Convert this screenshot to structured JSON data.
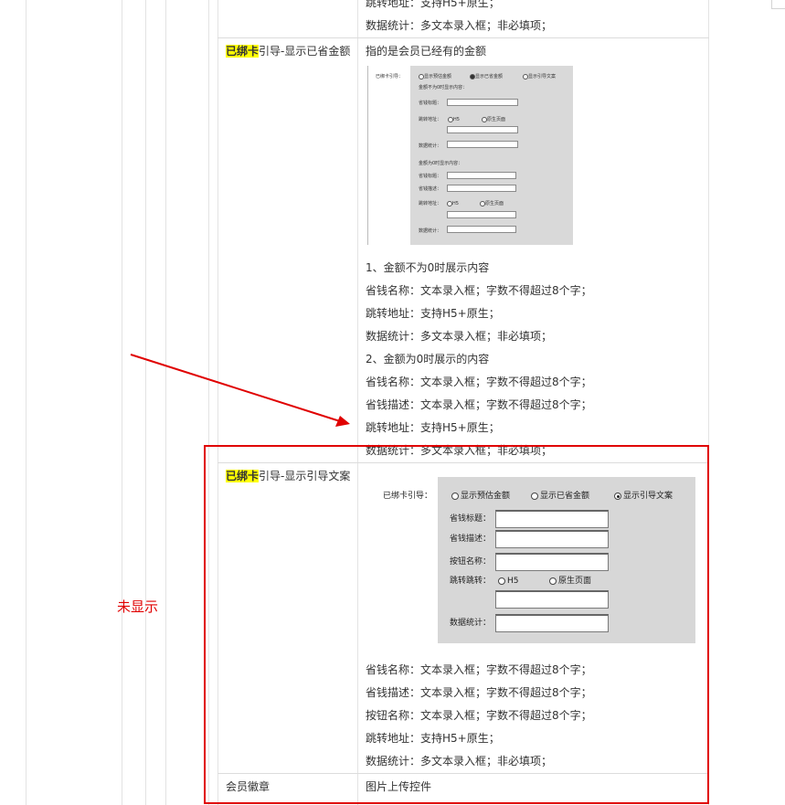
{
  "rows": {
    "top_fragment": {
      "line1": "跳转地址：支持H5+原生；",
      "line2": "数据统计：多文本录入框；非必填项；"
    },
    "row_saved_amount": {
      "label_highlight": "已绑卡",
      "label_rest": "引导-显示已省金额",
      "description": "指的是会员已经有的金额",
      "notes": [
        "1、金额不为0时展示内容",
        "省钱名称：文本录入框；字数不得超过8个字；",
        "跳转地址：支持H5+原生；",
        "数据统计：多文本录入框；非必填项；",
        "2、金额为0时展示的内容",
        "省钱名称：文本录入框；字数不得超过8个字；",
        "省钱描述：文本录入框；字数不得超过8个字；",
        "跳转地址：支持H5+原生；",
        "数据统计：多文本录入框；非必填项；"
      ]
    },
    "row_guide_text": {
      "label_highlight": "已绑卡",
      "label_rest": "引导-显示引导文案",
      "notes": [
        "省钱名称：文本录入框；字数不得超过8个字；",
        "省钱描述：文本录入框；字数不得超过8个字；",
        "按钮名称：文本录入框；字数不得超过8个字；",
        "跳转地址：支持H5+原生；",
        "数据统计：多文本录入框；非必填项；"
      ]
    },
    "row_badge": {
      "label": "会员徽章",
      "description": "图片上传控件"
    }
  },
  "annotation": {
    "text": "未显示",
    "color": "#e00000"
  },
  "screenshot_small": {
    "guide_label": "已绑卡引导：",
    "radio_options": [
      "显示预估金额",
      "显示已省金额",
      "显示引导文案"
    ],
    "selected_option": "显示已省金额",
    "section1_title": "金额不为0时显示内容：",
    "section2_title": "金额为0时显示内容：",
    "field_title": "省钱标题：",
    "field_desc": "省钱描述：",
    "field_jump": "跳转地址：",
    "field_stats": "数据统计：",
    "jump_options": [
      "H5",
      "原生页面"
    ]
  },
  "screenshot_large": {
    "guide_label": "已绑卡引导：",
    "radio_options": [
      "显示预估金额",
      "显示已省金额",
      "显示引导文案"
    ],
    "selected_option": "显示引导文案",
    "field_title": "省钱标题：",
    "field_desc": "省钱描述：",
    "field_button": "按钮名称：",
    "field_jump": "跳转跳转：",
    "field_stats": "数据统计：",
    "jump_options": [
      "H5",
      "原生页面"
    ]
  },
  "colors": {
    "highlight": "#ffff00",
    "red_box": "#e00000",
    "panel_gray": "#d7d7d7"
  }
}
